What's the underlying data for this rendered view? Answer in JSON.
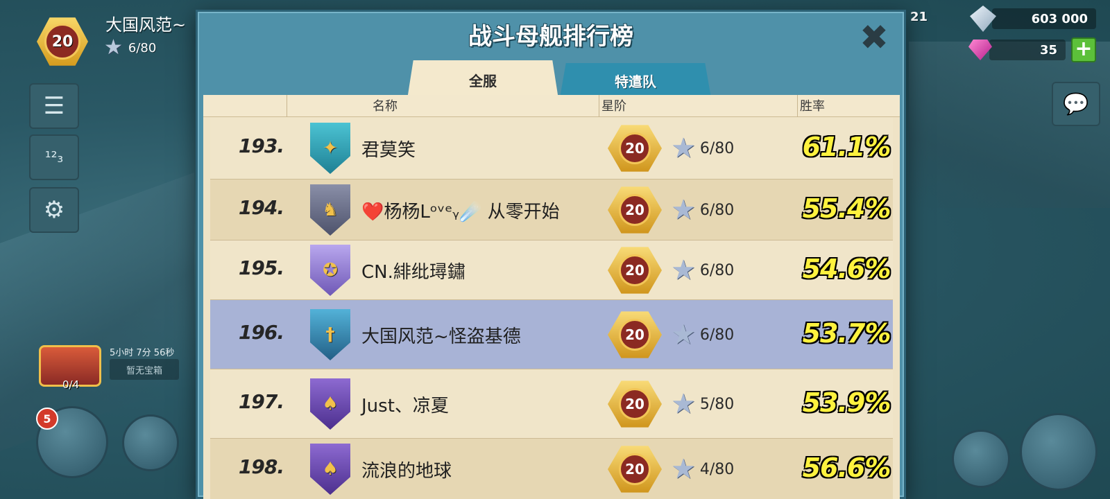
{
  "hud": {
    "level": "20",
    "player_name": "大国风范~",
    "stars": "6/80",
    "chest_timer": "5小时 7分 56秒",
    "chest_status": "暂无宝箱",
    "chest_count": "0/4",
    "notification_count": "5",
    "resource_partial": "21",
    "diamonds": "603 000",
    "gems": "35"
  },
  "modal": {
    "title": "战斗母舰排行榜",
    "tabs": [
      {
        "label": "全服",
        "active": true
      },
      {
        "label": "特遣队",
        "active": false
      }
    ],
    "columns": {
      "name": "名称",
      "rank_tier": "星阶",
      "win_rate": "胜率"
    },
    "rows": [
      {
        "rank": "193.",
        "name": "君莫笑",
        "level": "20",
        "stars": "6/80",
        "win_rate": "61.1%",
        "shield": "teal",
        "emblem": "✦"
      },
      {
        "rank": "194.",
        "name_prefix": "❤️",
        "name": "杨杨Lᵒᵛᵉᵧ☄️ 从零开始",
        "level": "20",
        "stars": "6/80",
        "win_rate": "55.4%",
        "shield": "grey",
        "emblem": "♞"
      },
      {
        "rank": "195.",
        "name": "CN.緋纰璕鏽",
        "level": "20",
        "stars": "6/80",
        "win_rate": "54.6%",
        "shield": "purple-light",
        "emblem": "✪"
      },
      {
        "rank": "196.",
        "name": "大国风范~怪盗基德",
        "level": "20",
        "stars": "6/80",
        "win_rate": "53.7%",
        "shield": "blue",
        "emblem": "†"
      },
      {
        "rank": "197.",
        "name": "Just、凉夏",
        "level": "20",
        "stars": "5/80",
        "win_rate": "53.9%",
        "shield": "purple",
        "emblem": "♠"
      },
      {
        "rank": "198.",
        "name": "流浪的地球",
        "level": "20",
        "stars": "4/80",
        "win_rate": "56.6%",
        "shield": "purple",
        "emblem": "♠"
      }
    ]
  },
  "colors": {
    "modal_bg": "#4f91a9",
    "board_bg": "#efe3c6",
    "highlight_row": "#a8b3d6",
    "win_rate_text": "#fff23e"
  }
}
